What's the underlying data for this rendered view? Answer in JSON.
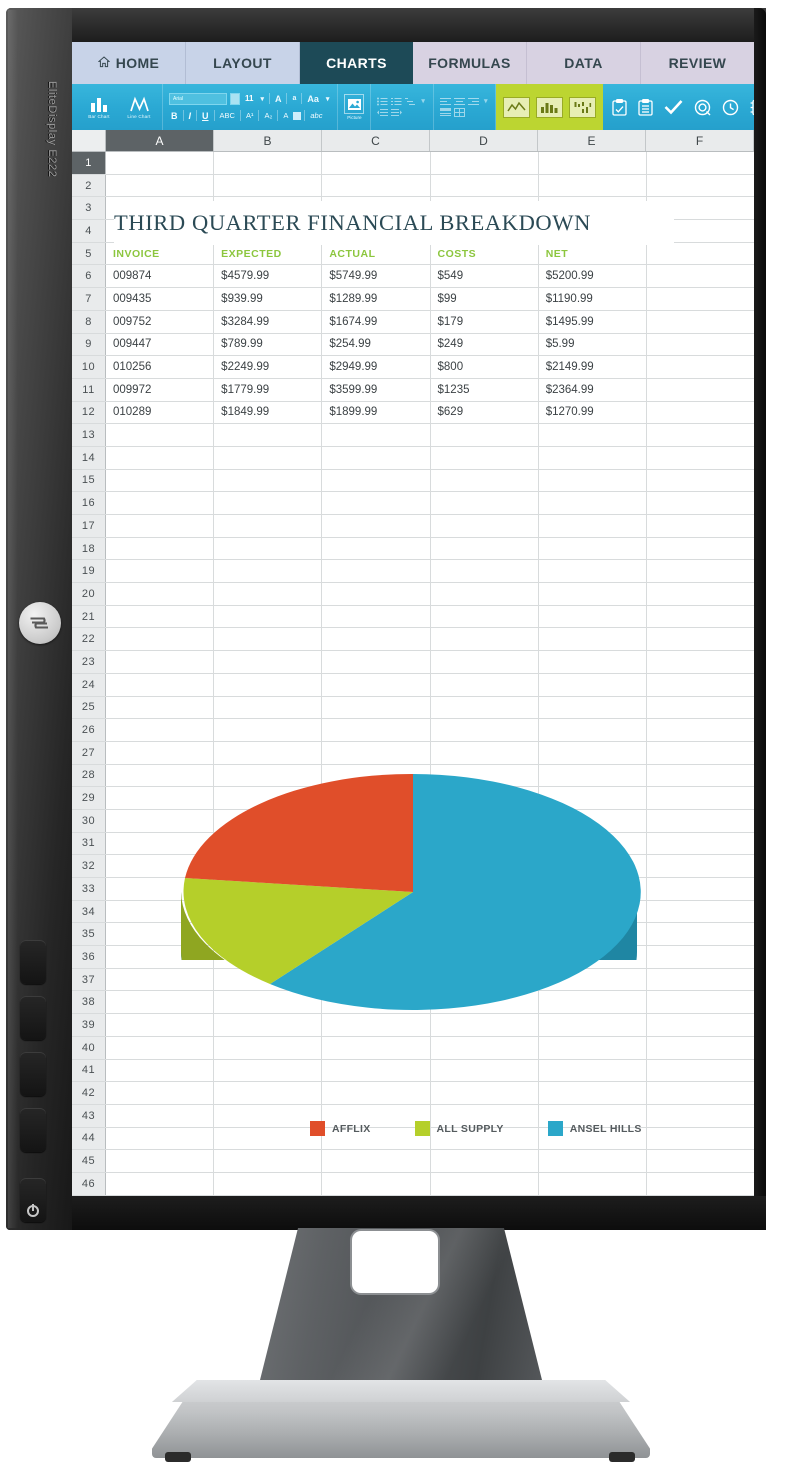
{
  "monitor": {
    "brand_text": "EliteDisplay E222",
    "logo": "hp-logo",
    "power_button": "power-icon"
  },
  "ribbon": {
    "tabs": [
      {
        "label": "HOME",
        "icon": "home-icon",
        "active": false,
        "style": "blue"
      },
      {
        "label": "LAYOUT",
        "icon": "",
        "active": false,
        "style": "blue"
      },
      {
        "label": "CHARTS",
        "icon": "",
        "active": true,
        "style": "active"
      },
      {
        "label": "FORMULAS",
        "icon": "",
        "active": false,
        "style": "lavender"
      },
      {
        "label": "DATA",
        "icon": "",
        "active": false,
        "style": "lavender"
      },
      {
        "label": "REVIEW",
        "icon": "",
        "active": false,
        "style": "lavender"
      }
    ],
    "chart_buttons": [
      {
        "label": "Bar Chart",
        "icon": "bar-chart-icon"
      },
      {
        "label": "Line Chart",
        "icon": "line-chart-icon"
      }
    ],
    "font": {
      "name": "Arial",
      "size": "11",
      "grow_label": "A",
      "shrink_label": "a",
      "case_label": "Aa",
      "bold_label": "B",
      "italic_label": "I",
      "underline_label": "U",
      "strike_label": "ABC",
      "superscript_label": "A¹",
      "subscript_label": "A₂",
      "highlight_label": "A",
      "smallcaps_label": "abc"
    },
    "picture_label": "Picture",
    "highlighted_chart_icons": [
      "line-chart-icon",
      "column-chart-icon",
      "scatter-chart-icon"
    ],
    "right_icons": [
      "clipboard-check-icon",
      "clipboard-list-icon",
      "check-icon",
      "target-icon",
      "clock-icon",
      "contact-card-icon"
    ]
  },
  "sheet": {
    "columns": [
      "A",
      "B",
      "C",
      "D",
      "E",
      "F"
    ],
    "selected_column": "A",
    "title": "THIRD QUARTER FINANCIAL BREAKDOWN",
    "header_row_index": 5,
    "headers": [
      "INVOICE",
      "EXPECTED",
      "ACTUAL",
      "COSTS",
      "NET"
    ],
    "header_color": "#8cc63e",
    "rows": [
      {
        "n": "6",
        "cells": [
          "009874",
          "$4579.99",
          "$5749.99",
          "$549",
          "$5200.99"
        ]
      },
      {
        "n": "7",
        "cells": [
          "009435",
          "$939.99",
          "$1289.99",
          "$99",
          "$1190.99"
        ]
      },
      {
        "n": "8",
        "cells": [
          "009752",
          "$3284.99",
          "$1674.99",
          "$179",
          "$1495.99"
        ]
      },
      {
        "n": "9",
        "cells": [
          "009447",
          "$789.99",
          "$254.99",
          "$249",
          "$5.99"
        ]
      },
      {
        "n": "10",
        "cells": [
          "010256",
          "$2249.99",
          "$2949.99",
          "$800",
          "$2149.99"
        ]
      },
      {
        "n": "11",
        "cells": [
          "009972",
          "$1779.99",
          "$3599.99",
          "$1235",
          "$2364.99"
        ]
      },
      {
        "n": "12",
        "cells": [
          "010289",
          "$1849.99",
          "$1899.99",
          "$629",
          "$1270.99"
        ]
      }
    ],
    "first_row": 1,
    "last_row": 46
  },
  "chart_data": {
    "type": "pie",
    "title": "",
    "style": "3d-pie",
    "categories": [
      "AFFLIX",
      "ALL SUPPLY",
      "ANSEL HILLS"
    ],
    "values": [
      13,
      22,
      65
    ],
    "colors": [
      "#e04e2a",
      "#b5cf2a",
      "#2ba7c9"
    ],
    "side_colors": [
      "#b33d20",
      "#8fa621",
      "#1f86a3"
    ],
    "legend_position": "bottom",
    "grid": true
  }
}
